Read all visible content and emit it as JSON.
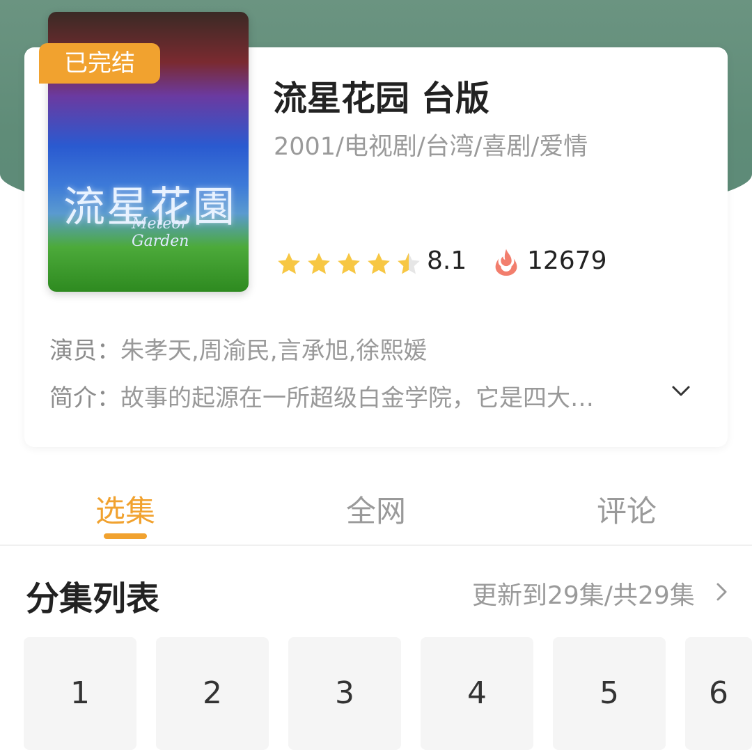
{
  "show": {
    "status": "已完结",
    "title": "流星花园 台版",
    "meta": "2001/电视剧/台湾/喜剧/爱情",
    "rating": "8.1",
    "rating_stars": 4.5,
    "heat": "12679",
    "poster_title": "流星花園",
    "poster_subtitle": "Meteor Garden"
  },
  "info": {
    "cast_label": "演员：",
    "cast_value": "朱孝天,周渝民,言承旭,徐熙媛",
    "summary_label": "简介：",
    "summary_value": "故事的起源在一所超级白金学院，它是四大…"
  },
  "tabs": [
    {
      "label": "选集",
      "active": true
    },
    {
      "label": "全网",
      "active": false
    },
    {
      "label": "评论",
      "active": false
    }
  ],
  "episodes_section": {
    "title": "分集列表",
    "update_info": "更新到29集/共29集"
  },
  "episodes": [
    "1",
    "2",
    "3",
    "4",
    "5",
    "6"
  ],
  "colors": {
    "accent": "#f1a22f",
    "header_bg": "#5f8c78",
    "star": "#f7c744"
  }
}
